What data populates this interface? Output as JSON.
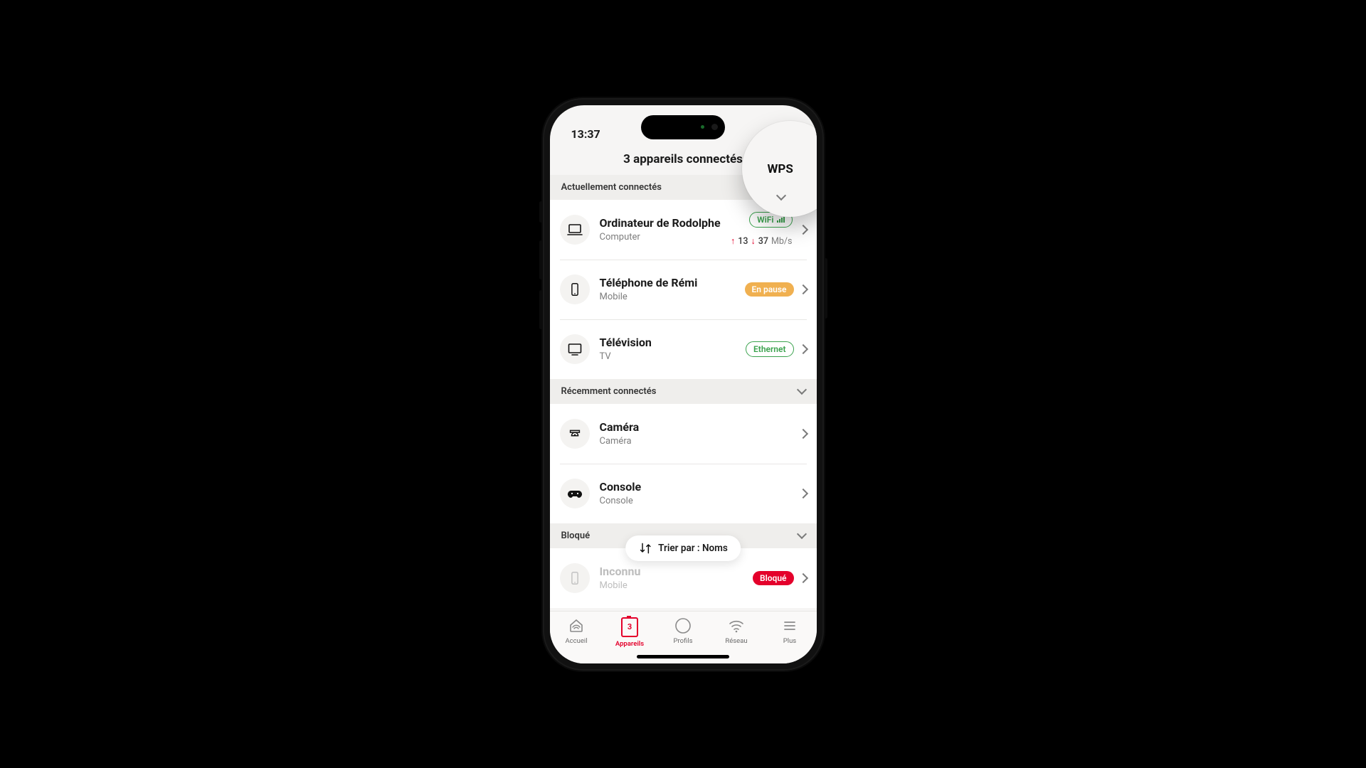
{
  "statusbar": {
    "time": "13:37"
  },
  "header": {
    "title": "3 appareils connectés",
    "wps": "WPS"
  },
  "sections": {
    "current": {
      "title": "Actuellement connectés"
    },
    "recent": {
      "title": "Récemment connectés"
    },
    "blocked": {
      "title": "Bloqué"
    }
  },
  "pills": {
    "wifi": "WiFi",
    "pause": "En pause",
    "ethernet": "Ethernet",
    "blocked": "Bloqué"
  },
  "devices": {
    "computer": {
      "name": "Ordinateur de Rodolphe",
      "type": "Computer",
      "up": "13",
      "down": "37",
      "unit": "Mb/s"
    },
    "phone": {
      "name": "Téléphone de Rémi",
      "type": "Mobile"
    },
    "tv": {
      "name": "Télévision",
      "type": "TV"
    },
    "camera": {
      "name": "Caméra",
      "type": "Caméra"
    },
    "console": {
      "name": "Console",
      "type": "Console"
    },
    "unknown": {
      "name": "Inconnu",
      "type": "Mobile"
    }
  },
  "sort": {
    "label": "Trier par : Noms"
  },
  "tabs": {
    "home": "Accueil",
    "devices": "Appareils",
    "profiles": "Profils",
    "network": "Réseau",
    "more": "Plus",
    "count": "3"
  }
}
